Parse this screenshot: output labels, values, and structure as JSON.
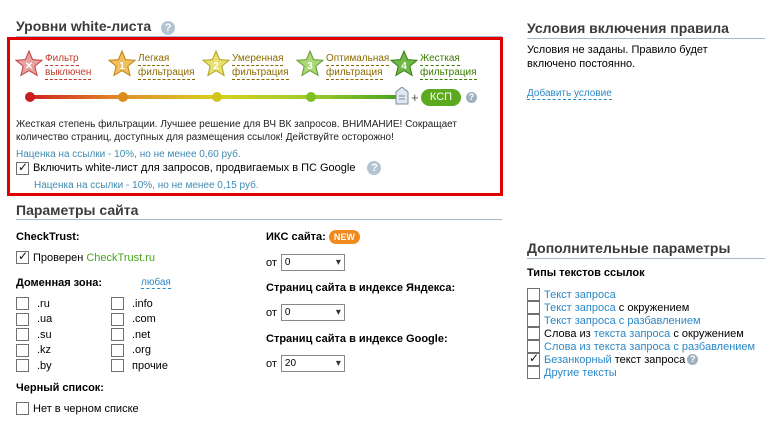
{
  "whitelist": {
    "title": "Уровни white-листа",
    "help": "?",
    "levels": [
      {
        "line1": "Фильтр",
        "line2": "выключен",
        "color": "#c0392b",
        "number": "✕"
      },
      {
        "line1": "Легкая",
        "line2": "фильтрация",
        "color": "#8a6a00",
        "number": "1"
      },
      {
        "line1": "Умеренная",
        "line2": "фильтрация",
        "color": "#8a6a00",
        "number": "2"
      },
      {
        "line1": "Оптимальная",
        "line2": "фильтрация",
        "color": "#8a6a00",
        "number": "3"
      },
      {
        "line1": "Жесткая",
        "line2": "фильтрация",
        "color": "#3a7a00",
        "number": "4"
      }
    ],
    "plus": "+",
    "ksp_label": "КСП",
    "description": "Жесткая степень фильтрации. Лучшее решение для ВЧ ВК запросов. ВНИМАНИЕ! Сокращает количество страниц, доступных для размещения ссылок! Действуйте осторожно!",
    "markup": "Наценка на ссылки - 10%, но не менее 0,60 руб.",
    "google_checkbox": "Включить white-лист для запросов, продвигаемых в ПС Google",
    "google_markup": "Наценка на ссылки - 10%, но не менее 0,15 руб."
  },
  "conditions": {
    "title": "Условия включения правила",
    "text": "Условия не заданы. Правило будет включено постоянно.",
    "add_link": "Добавить условие"
  },
  "site_params": {
    "title": "Параметры сайта",
    "checktrust_label": "CheckTrust:",
    "checktrust_checked_prefix": "Проверен ",
    "checktrust_link": "CheckTrust.ru",
    "zone_label": "Доменная зона:",
    "zone_any": "любая",
    "zones_left": [
      ".ru",
      ".ua",
      ".su",
      ".kz",
      ".by"
    ],
    "zones_right": [
      ".info",
      ".com",
      ".net",
      ".org",
      "прочие"
    ],
    "blacklist_label": "Черный список:",
    "blacklist_option": "Нет в черном списке",
    "iks_label": "ИКС сайта:",
    "new_badge": "NEW",
    "from": "от",
    "iks_value": "0",
    "yandex_label": "Страниц сайта в индексе Яндекса:",
    "yandex_value": "0",
    "google_label": "Страниц сайта в индексе Google:",
    "google_value": "20"
  },
  "extra": {
    "title": "Дополнительные параметры",
    "types_label": "Типы текстов ссылок",
    "types": [
      {
        "parts": [
          {
            "t": "Текст запроса",
            "link": true
          }
        ],
        "checked": false
      },
      {
        "parts": [
          {
            "t": "Текст запроса",
            "link": true
          },
          {
            "t": " с окружением",
            "link": false
          }
        ],
        "checked": false
      },
      {
        "parts": [
          {
            "t": "Текст запроса с разбавлением",
            "link": true
          }
        ],
        "checked": false
      },
      {
        "parts": [
          {
            "t": "Слова из ",
            "link": false
          },
          {
            "t": "текста запроса",
            "link": true
          },
          {
            "t": " с окружением",
            "link": false
          }
        ],
        "checked": false
      },
      {
        "parts": [
          {
            "t": "Слова из текста запроса с разбавлением",
            "link": true
          }
        ],
        "checked": false
      },
      {
        "parts": [
          {
            "t": "Безанкорный",
            "link": true
          },
          {
            "t": " текст запроса",
            "link": false
          }
        ],
        "checked": true,
        "help": true
      },
      {
        "parts": [
          {
            "t": "Другие тексты",
            "link": true
          }
        ],
        "checked": false
      }
    ]
  },
  "colors": {
    "red_frame": "#e00000",
    "accent_green": "#5aa91e",
    "link_blue": "#2b88c7",
    "teal_text": "#3f8bb0"
  }
}
